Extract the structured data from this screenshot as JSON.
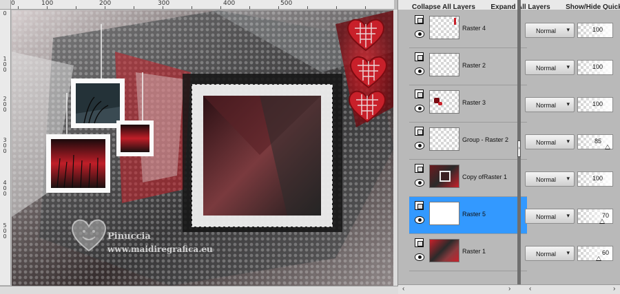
{
  "toolbar": {
    "collapse_all": "Collapse All Layers",
    "expand_all": "Expand All Layers",
    "show_hide_quick": "Show/Hide Quick S"
  },
  "ruler": {
    "h_labels": [
      "0",
      "100",
      "200",
      "300",
      "400",
      "500"
    ],
    "v_labels": [
      "0",
      "1\n0\n0",
      "2\n0\n0",
      "3\n0\n0",
      "4\n0\n0",
      "5\n0\n0"
    ]
  },
  "canvas": {
    "watermark_name": "Pinuccia",
    "watermark_url": "www.maidiregrafica.eu"
  },
  "layers": [
    {
      "name": "Raster 4",
      "blend": "Normal",
      "opacity": "100",
      "selected": false
    },
    {
      "name": "Raster 2",
      "blend": "Normal",
      "opacity": "100",
      "selected": false
    },
    {
      "name": "Raster 3",
      "blend": "Normal",
      "opacity": "100",
      "selected": false
    },
    {
      "name": "Group - Raster 2",
      "blend": "Normal",
      "opacity": "85",
      "selected": false
    },
    {
      "name": "Copy ofRaster 1",
      "blend": "Normal",
      "opacity": "100",
      "selected": false
    },
    {
      "name": "Raster 5",
      "blend": "Normal",
      "opacity": "70",
      "selected": true
    },
    {
      "name": "Raster 1",
      "blend": "Normal",
      "opacity": "60",
      "selected": false
    }
  ],
  "colors": {
    "selection": "#3399ff",
    "accent_red": "#c8202a",
    "panel_bg": "#b9b9b9"
  }
}
